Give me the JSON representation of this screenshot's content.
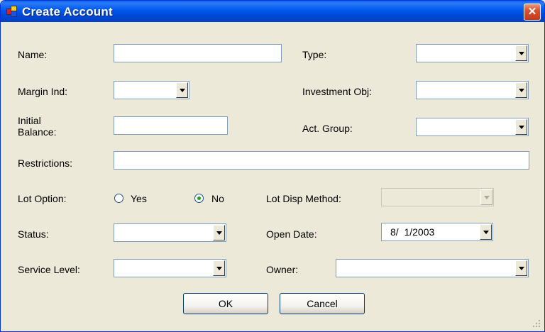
{
  "window": {
    "title": "Create Account",
    "close_glyph": "✕",
    "icon": "app-window-icon"
  },
  "form": {
    "name_label": "Name:",
    "type_label": "Type:",
    "margin_ind_label": "Margin Ind:",
    "investment_obj_label": "Investment Obj:",
    "initial_balance_label_line1": "Initial",
    "initial_balance_label_line2": "Balance:",
    "act_group_label": "Act. Group:",
    "restrictions_label": "Restrictions:",
    "lot_option_label": "Lot Option:",
    "lot_option_yes": "Yes",
    "lot_option_no": "No",
    "lot_option_selected": "No",
    "lot_disp_method_label": "Lot Disp Method:",
    "status_label": "Status:",
    "open_date_label": "Open Date:",
    "open_date_value": "8/  1/2003",
    "service_level_label": "Service Level:",
    "owner_label": "Owner:"
  },
  "buttons": {
    "ok": "OK",
    "cancel": "Cancel"
  }
}
